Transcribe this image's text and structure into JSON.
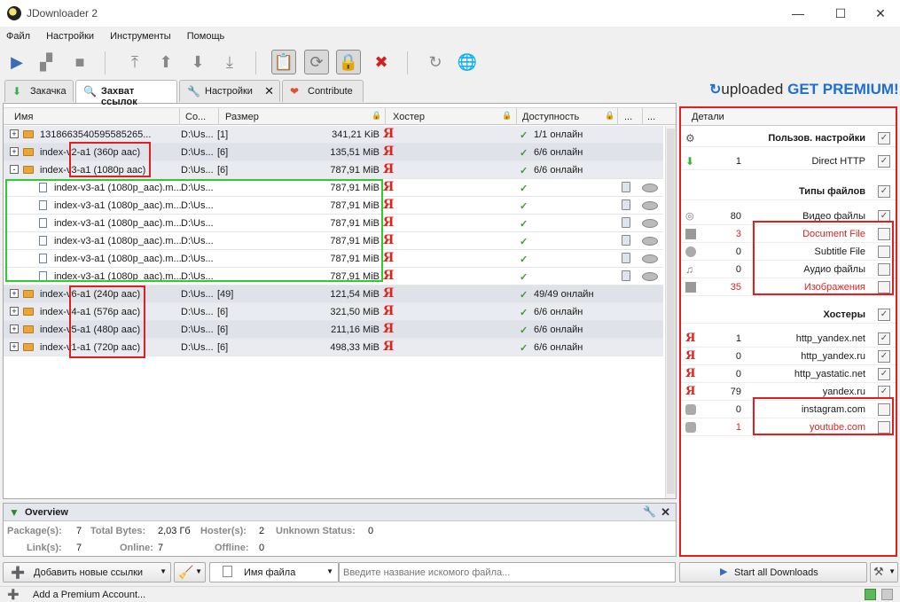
{
  "window": {
    "title": "JDownloader 2",
    "minimize": "—",
    "maximize": "☐",
    "close": "✕"
  },
  "menu": [
    "Файл",
    "Настройки",
    "Инструменты",
    "Помощь"
  ],
  "tabs": [
    {
      "label": "Закачка"
    },
    {
      "label": "Захват ссылок"
    },
    {
      "label": "Настройки"
    },
    {
      "label": "Contribute"
    }
  ],
  "premium_banner": {
    "brand": "uploaded",
    "text": "GET PREMIUM!"
  },
  "columns": {
    "name": "Имя",
    "save_to": "Со...",
    "size": "Размер",
    "hoster": "Хостер",
    "availability": "Доступность",
    "more1": "...",
    "more2": "..."
  },
  "rows": [
    {
      "type": "package",
      "expander": "+",
      "name": "1318663540595585265...",
      "save_to": "D:\\Us...",
      "count": "[1]",
      "size": "341,21 KiB",
      "availability": "1/1 онлайн"
    },
    {
      "type": "package",
      "expander": "+",
      "name": "index-v2-a1 (360p aac)",
      "save_to": "D:\\Us...",
      "count": "[6]",
      "size": "135,51 MiB",
      "availability": "6/6 онлайн"
    },
    {
      "type": "package",
      "expander": "-",
      "name": "index-v3-a1 (1080p aac)",
      "save_to": "D:\\Us...",
      "count": "[6]",
      "size": "787,91 MiB",
      "availability": "6/6 онлайн"
    },
    {
      "type": "child",
      "name": "index-v3-a1 (1080p_aac).m...",
      "save_to": "D:\\Us...",
      "count": "",
      "size": "787,91 MiB",
      "availability": ""
    },
    {
      "type": "child",
      "name": "index-v3-a1 (1080p_aac).m...",
      "save_to": "D:\\Us...",
      "count": "",
      "size": "787,91 MiB",
      "availability": ""
    },
    {
      "type": "child",
      "name": "index-v3-a1 (1080p_aac).m...",
      "save_to": "D:\\Us...",
      "count": "",
      "size": "787,91 MiB",
      "availability": ""
    },
    {
      "type": "child",
      "name": "index-v3-a1 (1080p_aac).m...",
      "save_to": "D:\\Us...",
      "count": "",
      "size": "787,91 MiB",
      "availability": ""
    },
    {
      "type": "child",
      "name": "index-v3-a1 (1080p_aac).m...",
      "save_to": "D:\\Us...",
      "count": "",
      "size": "787,91 MiB",
      "availability": ""
    },
    {
      "type": "child",
      "name": "index-v3-a1 (1080p_aac).m...",
      "save_to": "D:\\Us...",
      "count": "",
      "size": "787,91 MiB",
      "availability": ""
    },
    {
      "type": "package",
      "expander": "+",
      "name": "index-v6-a1 (240p aac)",
      "save_to": "D:\\Us...",
      "count": "[49]",
      "size": "121,54 MiB",
      "availability": "49/49 онлайн"
    },
    {
      "type": "package",
      "expander": "+",
      "name": "index-v4-a1 (576p aac)",
      "save_to": "D:\\Us...",
      "count": "[6]",
      "size": "321,50 MiB",
      "availability": "6/6 онлайн"
    },
    {
      "type": "package",
      "expander": "+",
      "name": "index-v5-a1 (480p aac)",
      "save_to": "D:\\Us...",
      "count": "[6]",
      "size": "211,16 MiB",
      "availability": "6/6 онлайн"
    },
    {
      "type": "package",
      "expander": "+",
      "name": "index-v1-a1 (720p aac)",
      "save_to": "D:\\Us...",
      "count": "[6]",
      "size": "498,33 MiB",
      "availability": "6/6 онлайн"
    }
  ],
  "hoster_glyph": "Я",
  "check_glyph": "✓",
  "details": {
    "header": "Детали",
    "items": [
      {
        "section": true,
        "label": "Пользов. настройки",
        "count": "",
        "checked": true,
        "icon": "gear-icon"
      },
      {
        "section": false,
        "label": "Direct HTTP",
        "count": "1",
        "checked": true,
        "icon": "download-arrow-icon"
      },
      {
        "section": true,
        "label": "Типы файлов",
        "count": "",
        "checked": true,
        "icon": ""
      },
      {
        "section": false,
        "label": "Видео файлы",
        "count": "80",
        "checked": true,
        "icon": "video-reel-icon"
      },
      {
        "section": false,
        "label": "Document File",
        "count": "3",
        "checked": false,
        "red": true,
        "icon": "document-icon"
      },
      {
        "section": false,
        "label": "Subtitle File",
        "count": "0",
        "checked": false,
        "icon": "subtitle-icon"
      },
      {
        "section": false,
        "label": "Аудио файлы",
        "count": "0",
        "checked": false,
        "icon": "music-note-icon"
      },
      {
        "section": false,
        "label": "Изображения",
        "count": "35",
        "checked": false,
        "red": true,
        "icon": "image-icon"
      },
      {
        "section": true,
        "label": "Хостеры",
        "count": "",
        "checked": true,
        "icon": ""
      },
      {
        "section": false,
        "label": "http_yandex.net",
        "count": "1",
        "checked": true,
        "icon": "yandex-icon"
      },
      {
        "section": false,
        "label": "http_yandex.ru",
        "count": "0",
        "checked": true,
        "icon": "yandex-icon"
      },
      {
        "section": false,
        "label": "http_yastatic.net",
        "count": "0",
        "checked": true,
        "icon": "yandex-icon"
      },
      {
        "section": false,
        "label": "yandex.ru",
        "count": "79",
        "checked": true,
        "icon": "yandex-icon"
      },
      {
        "section": false,
        "label": "instagram.com",
        "count": "0",
        "checked": false,
        "icon": "instagram-icon"
      },
      {
        "section": false,
        "label": "youtube.com",
        "count": "1",
        "checked": false,
        "red": true,
        "icon": "youtube-icon"
      }
    ]
  },
  "overview": {
    "title": "Overview",
    "packages_k": "Package(s):",
    "packages_v": "7",
    "total_bytes_k": "Total Bytes:",
    "total_bytes_v": "2,03 Гб",
    "hosters_k": "Hoster(s):",
    "hosters_v": "2",
    "unknown_k": "Unknown Status:",
    "unknown_v": "0",
    "links_k": "Link(s):",
    "links_v": "7",
    "online_k": "Online:",
    "online_v": "7",
    "offline_k": "Offline:",
    "offline_v": "0"
  },
  "bottom": {
    "add_links": "Добавить новые ссылки",
    "filter_field": "Имя файла",
    "search_placeholder": "Введите название искомого файла...",
    "start_all": "Start all Downloads"
  },
  "status": {
    "add_premium": "Add a Premium Account..."
  },
  "colors": {
    "highlight_red": "#e02020",
    "highlight_green": "#2ecc2e",
    "yandex_red": "#e0231a",
    "online_green": "#3a9a2a"
  }
}
